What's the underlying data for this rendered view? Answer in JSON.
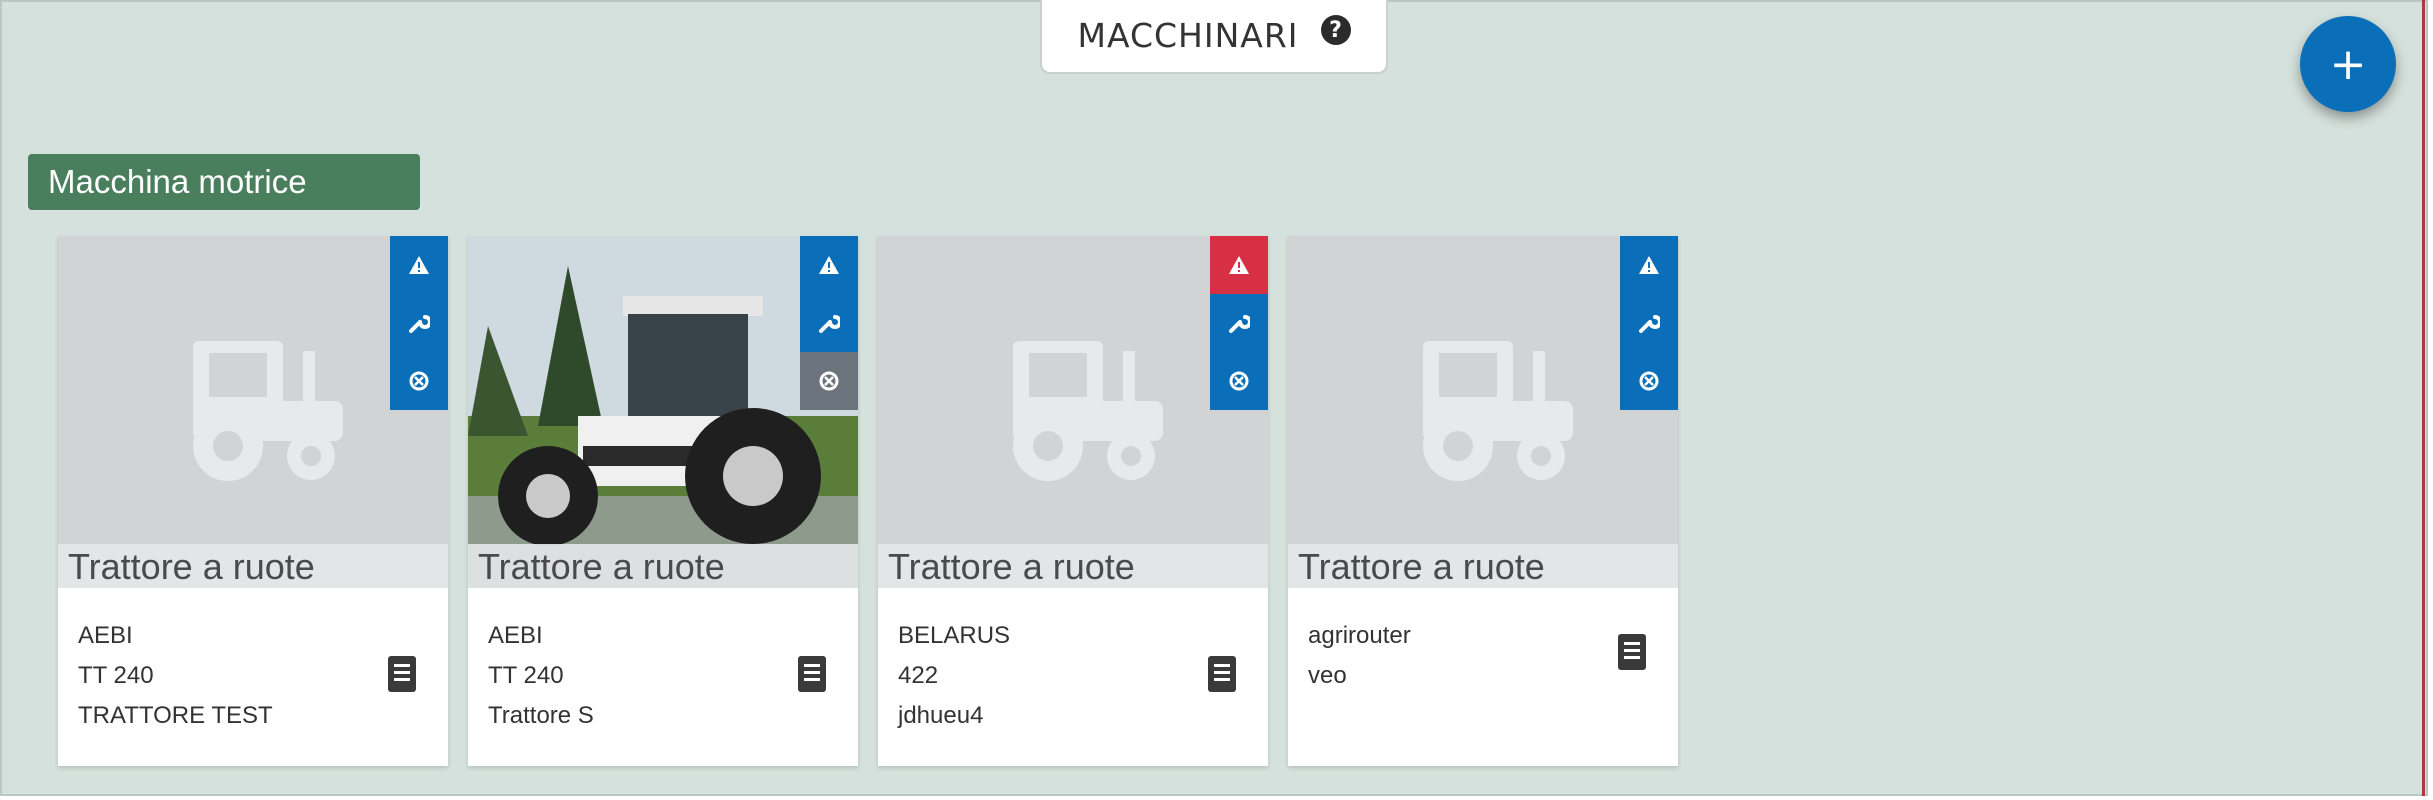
{
  "section": {
    "title": "MACCHINARI",
    "help_icon": "?",
    "add_button": "+",
    "category": "Macchina motrice"
  },
  "colors": {
    "panel_bg": "#d5e1dc",
    "brand_blue": "#0a6fb8",
    "category_green": "#4a7f5d",
    "alert_red": "#d92f45"
  },
  "cards": [
    {
      "type_label": "Trattore a ruote",
      "lines": [
        "AEBI",
        "TT 240",
        "TRATTORE TEST"
      ],
      "alert_state": "normal",
      "has_photo": false
    },
    {
      "type_label": "Trattore a ruote",
      "lines": [
        "AEBI",
        "TT 240",
        "Trattore S"
      ],
      "alert_state": "normal",
      "has_photo": true
    },
    {
      "type_label": "Trattore a ruote",
      "lines": [
        "BELARUS",
        "422",
        "jdhueu4"
      ],
      "alert_state": "warning",
      "has_photo": false
    },
    {
      "type_label": "Trattore a ruote",
      "lines": [
        "agrirouter",
        "veo"
      ],
      "alert_state": "normal",
      "has_photo": false
    }
  ],
  "icons": {
    "alert": "warning-icon",
    "maintenance": "wrench-icon",
    "disable": "cancel-circle-icon",
    "document": "document-icon",
    "placeholder": "tractor-icon"
  }
}
